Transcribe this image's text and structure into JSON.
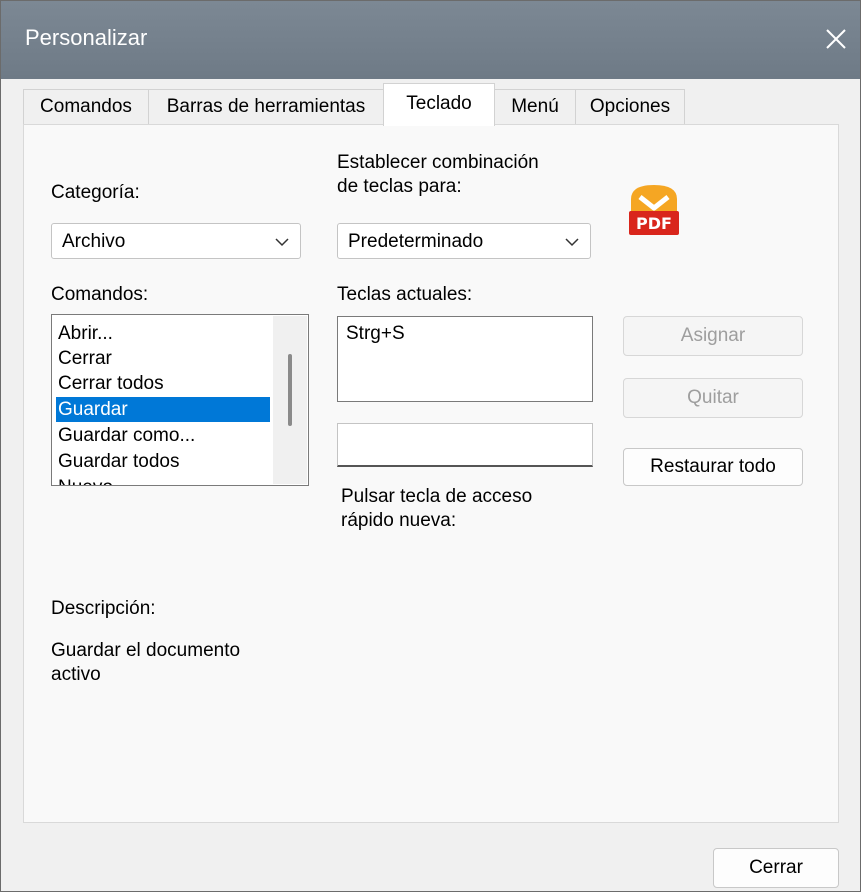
{
  "window": {
    "title": "Personalizar"
  },
  "tabs": [
    {
      "label": "Comandos",
      "active": false
    },
    {
      "label": "Barras de herramientas",
      "active": false
    },
    {
      "label": "Teclado",
      "active": true
    },
    {
      "label": "Menú",
      "active": false
    },
    {
      "label": "Opciones",
      "active": false
    }
  ],
  "category": {
    "label": "Categoría:",
    "value": "Archivo"
  },
  "set_keys": {
    "label": "Establecer combinación de teclas para:",
    "line1": "Establecer combinación",
    "line2": "de teclas para:",
    "value": "Predeterminado"
  },
  "commands": {
    "label": "Comandos:",
    "items": [
      "Abrir...",
      "Cerrar",
      "Cerrar todos",
      "Guardar",
      "Guardar como...",
      "Guardar todos",
      "Nuevo"
    ],
    "selected": "Guardar"
  },
  "current_keys": {
    "label": "Teclas actuales:",
    "items": [
      "Strg+S"
    ]
  },
  "new_shortcut": {
    "label_line1": "Pulsar tecla de acceso",
    "label_line2": "rápido nueva:",
    "value": ""
  },
  "buttons": {
    "assign": "Asignar",
    "remove": "Quitar",
    "reset_all": "Restaurar todo",
    "close": "Cerrar"
  },
  "description": {
    "label": "Descripción:",
    "line1": "Guardar el documento",
    "line2": "activo"
  },
  "icons": {
    "close": "close-icon",
    "chevron": "chevron-down-icon",
    "pdf": "pdf-file-icon"
  },
  "colors": {
    "titlebar": "#76828e",
    "selection": "#0078d7",
    "pdf_orange": "#f5a623",
    "pdf_red": "#d9261c"
  }
}
